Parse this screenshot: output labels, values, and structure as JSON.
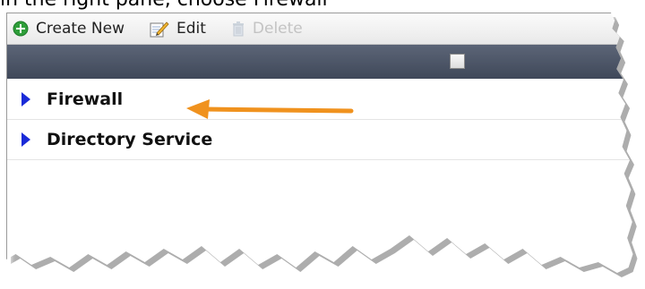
{
  "caption": "in the right pane, choose Firewall",
  "toolbar": {
    "create_label": "Create New",
    "edit_label": "Edit",
    "delete_label": "Delete"
  },
  "list": {
    "rows": [
      {
        "label": "Firewall"
      },
      {
        "label": "Directory Service"
      }
    ]
  },
  "colors": {
    "header": "#4a5366",
    "expander": "#1a2bd8",
    "arrow": "#f0921e",
    "create_icon": "#2f9e3a"
  },
  "icons": {
    "create": "plus-circle-icon",
    "edit": "pencil-notepad-icon",
    "delete": "trash-can-icon",
    "expand": "triangle-right-icon",
    "callout": "arrow-left-icon"
  }
}
